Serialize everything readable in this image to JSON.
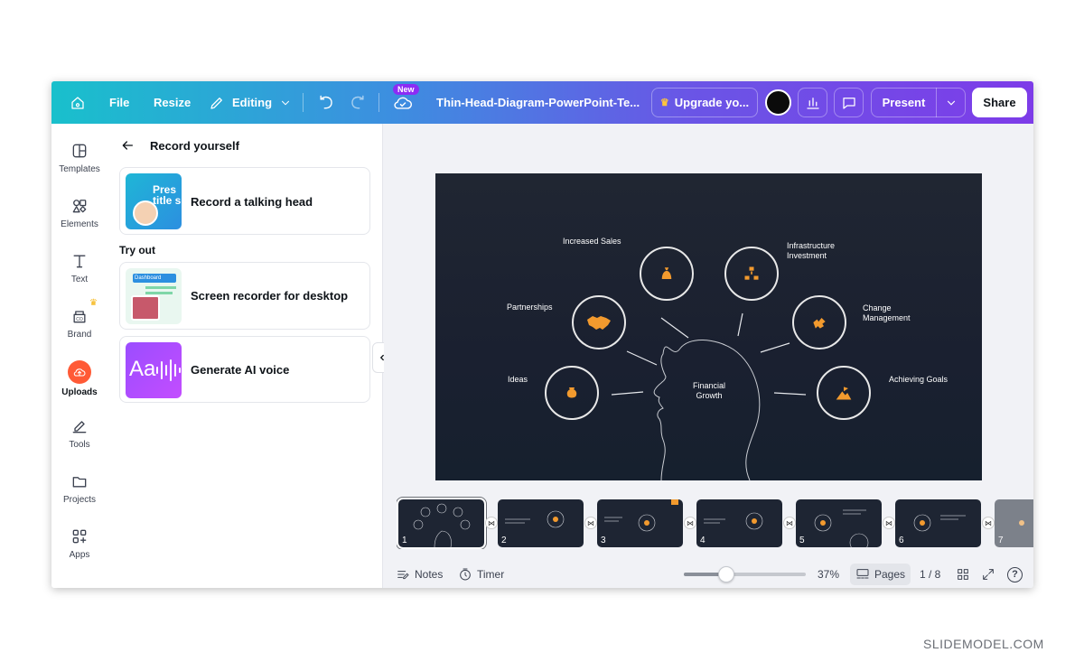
{
  "topbar": {
    "file_label": "File",
    "resize_label": "Resize",
    "editing_label": "Editing",
    "new_badge": "New",
    "doc_title": "Thin-Head-Diagram-PowerPoint-Te...",
    "upgrade_label": "Upgrade yo...",
    "present_label": "Present",
    "share_label": "Share"
  },
  "rail": {
    "items": [
      {
        "label": "Templates",
        "icon": "templates-icon"
      },
      {
        "label": "Elements",
        "icon": "elements-icon"
      },
      {
        "label": "Text",
        "icon": "text-icon"
      },
      {
        "label": "Brand",
        "icon": "brand-icon"
      },
      {
        "label": "Uploads",
        "icon": "uploads-icon"
      },
      {
        "label": "Tools",
        "icon": "tools-icon"
      },
      {
        "label": "Projects",
        "icon": "projects-icon"
      },
      {
        "label": "Apps",
        "icon": "apps-icon"
      }
    ]
  },
  "panel": {
    "title": "Record yourself",
    "record_talking_head": "Record a talking head",
    "thumb_text": "Pres\ntitle s",
    "try_out": "Try out",
    "screen_recorder": "Screen recorder for desktop",
    "screen_thumb_text": "Dashboard",
    "ai_voice": "Generate AI voice",
    "ai_thumb_text": "Aa"
  },
  "slide": {
    "center": "Financial\nGrowth",
    "labels": {
      "increased_sales": "Increased Sales",
      "infrastructure": "Infrastructure\nInvestment",
      "partnerships": "Partnerships",
      "change": "Change\nManagement",
      "ideas": "Ideas",
      "goals": "Achieving Goals"
    }
  },
  "pages": {
    "numbers": [
      "1",
      "2",
      "3",
      "4",
      "5",
      "6",
      "7"
    ]
  },
  "bottombar": {
    "notes": "Notes",
    "timer": "Timer",
    "zoom": "37%",
    "pages": "Pages",
    "page_count": "1 / 8",
    "help": "?"
  },
  "watermark": "SLIDEMODEL.COM",
  "colors": {
    "accent_orange": "#f29a2e",
    "slide_bg": "#1e2533",
    "brand_purple": "#8c2cf5"
  }
}
